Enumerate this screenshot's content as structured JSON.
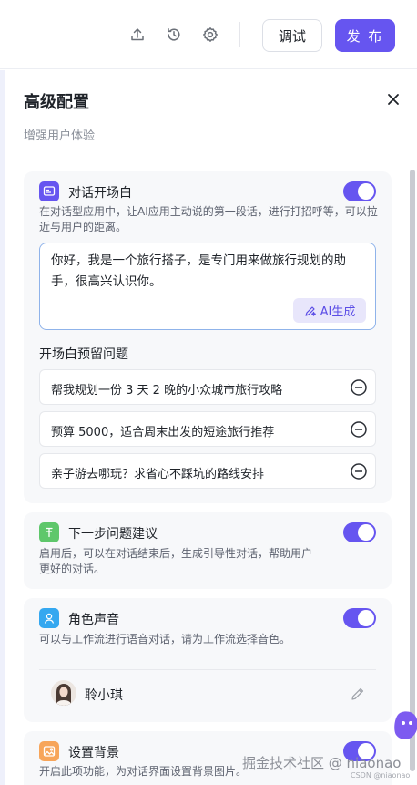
{
  "toolbar": {
    "debug_label": "调试",
    "publish_label": "发 布",
    "icons": [
      "upload-icon",
      "history-icon",
      "settings-icon"
    ]
  },
  "panel": {
    "title": "高级配置",
    "subtitle": "增强用户体验",
    "close_icon": "close-icon"
  },
  "opening": {
    "title": "对话开场白",
    "enabled": true,
    "description": "在对话型应用中，让AI应用主动说的第一段话，进行打招呼等，可以拉近与用户的距离。",
    "text": "你好，我是一个旅行搭子，是专门用来做旅行规划的助手，很高兴认识你。",
    "ai_button_label": "AI生成",
    "questions_label": "开场白预留问题",
    "questions": [
      "帮我规划一份 3 天 2 晚的小众城市旅行攻略",
      "预算 5000，适合周末出发的短途旅行推荐",
      "亲子游去哪玩？求省心不踩坑的路线安排"
    ]
  },
  "next_step": {
    "title": "下一步问题建议",
    "enabled": true,
    "description": "启用后，可以在对话结束后，生成引导性对话，帮助用户更好的对话。"
  },
  "voice": {
    "title": "角色声音",
    "enabled": true,
    "description": "可以与工作流进行语音对话，请为工作流选择音色。",
    "selected_voice": "聆小琪"
  },
  "background": {
    "title": "设置背景",
    "enabled": true,
    "description": "开启此项功能，为对话界面设置背景图片。"
  },
  "watermark": {
    "main": "掘金技术社区 @ niaonao",
    "sub": "CSDN @niaonao"
  },
  "colors": {
    "accent": "#6655f0",
    "opening_icon": "#6655f0",
    "next_step_icon": "#5ec76b",
    "voice_icon": "#35a8f0",
    "background_icon": "#f7a55a"
  }
}
